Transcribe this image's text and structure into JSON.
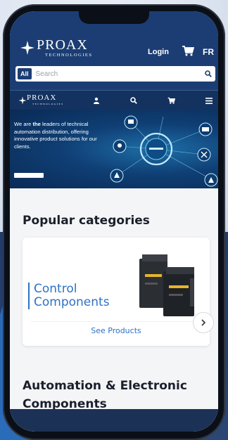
{
  "header": {
    "logo_name": "PROAX",
    "logo_sub": "TECHNOLOGIES",
    "login_label": "Login",
    "cart_icon": "shopping-cart-icon",
    "language_label": "FR"
  },
  "search": {
    "category_label": "All",
    "placeholder": "Search",
    "button_icon": "search-icon"
  },
  "nav": {
    "logo_name": "PROAX",
    "logo_sub": "TECHNOLOGIES",
    "icons": [
      "user-icon",
      "search-icon",
      "shopping-cart-icon",
      "menu-icon"
    ]
  },
  "hero": {
    "text_prefix": "We are ",
    "text_bold": "the",
    "text_suffix": " leaders of technical automation distribution, offering innovative product solutions for our clients."
  },
  "popular_categories": {
    "title": "Popular categories",
    "card": {
      "title": "Control Components",
      "link_label": "See Products"
    },
    "next_icon": "chevron-right-icon"
  },
  "automation_section": {
    "title": "Automation & Electronic Components"
  },
  "colors": {
    "header_bg": "#1b3d73",
    "nav_bg": "#13325f",
    "accent": "#2d72c4",
    "page_bg": "#f4f5f7"
  }
}
